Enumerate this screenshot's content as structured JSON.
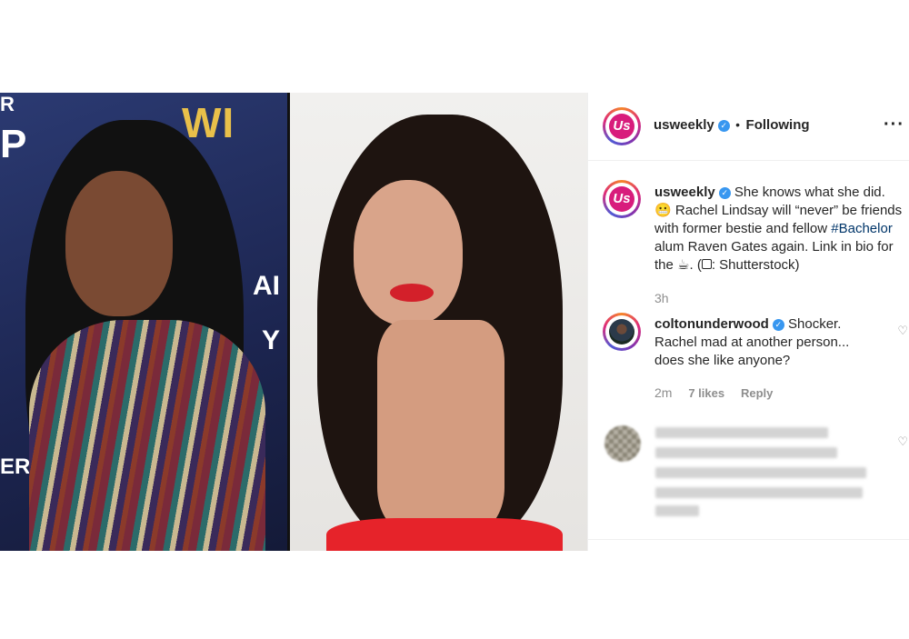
{
  "post": {
    "username": "usweekly",
    "follow_status": "Following",
    "separator": "•",
    "more_icon": "more-horizontal-icon",
    "avatar_text": "Us"
  },
  "caption": {
    "username": "usweekly",
    "text_1": "She knows what she did.",
    "emoji_1": "😬",
    "text_2": "Rachel Lindsay will “never” be friends with former bestie and fellow",
    "hashtag": "#Bachelor",
    "text_3": "alum Raven Gates again. Link in bio for the",
    "emoji_2": "☕",
    "text_4": ". (",
    "camera_icon": "camera-icon",
    "text_5": ": Shutterstock)",
    "time": "3h"
  },
  "comments": [
    {
      "username": "coltonunderwood",
      "text": "Shocker. Rachel mad at another person... does she like anyone?",
      "time": "2m",
      "likes": "7 likes",
      "reply": "Reply"
    }
  ],
  "backdrop": {
    "left_text_1": "R",
    "left_text_2": "P",
    "left_text_3": "ER",
    "right_gold": "WI",
    "left_white_mid": "AI",
    "left_white_mid2": "Y"
  },
  "colors": {
    "verified": "#3897f0",
    "brand": "#d81c7c",
    "muted": "#8e8e8e",
    "hashtag": "#003569"
  }
}
